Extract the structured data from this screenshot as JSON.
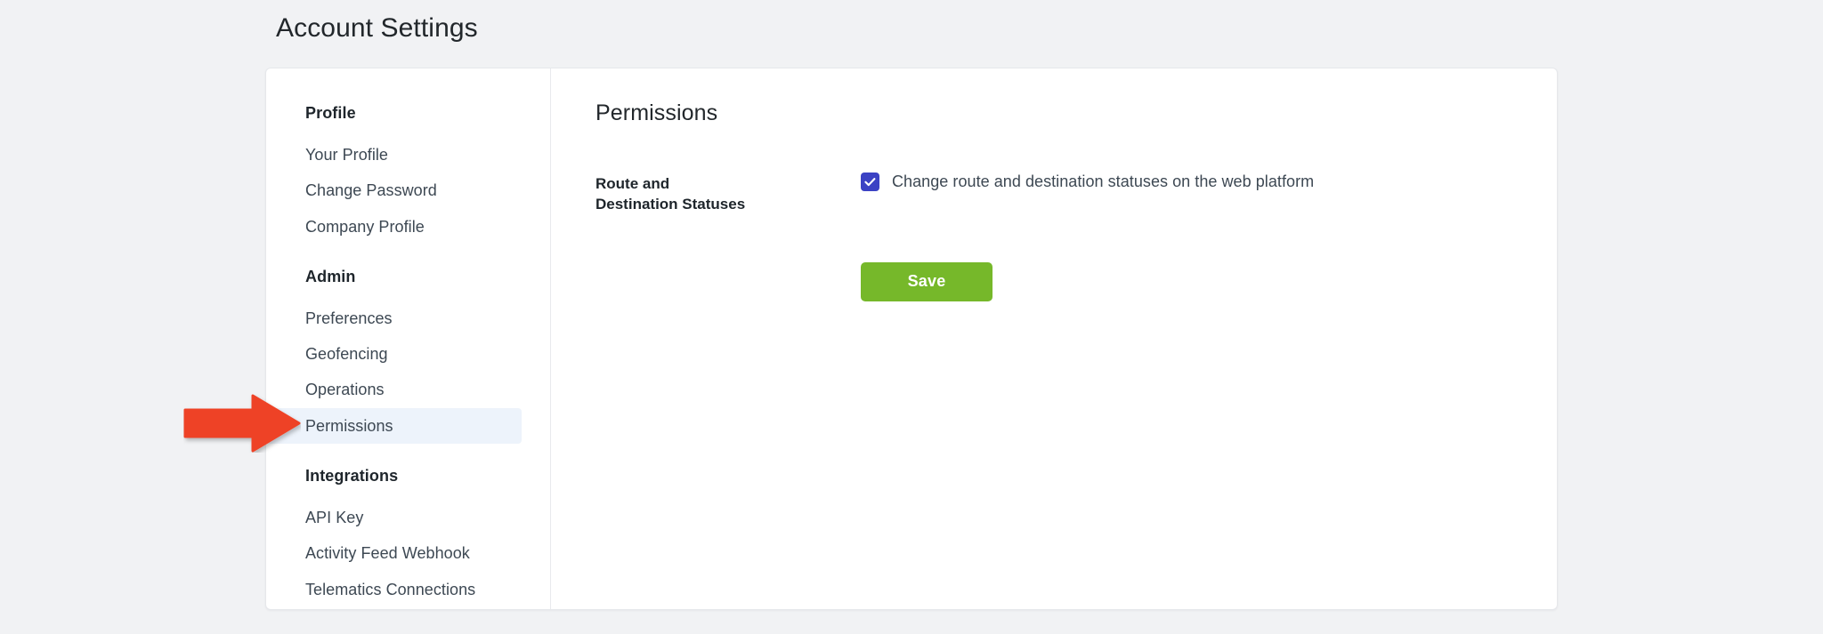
{
  "page": {
    "title": "Account Settings",
    "background_color": "#f1f2f4"
  },
  "sidebar": {
    "groups": [
      {
        "title": "Profile",
        "items": [
          {
            "label": "Your Profile",
            "active": false
          },
          {
            "label": "Change Password",
            "active": false
          },
          {
            "label": "Company Profile",
            "active": false
          }
        ]
      },
      {
        "title": "Admin",
        "items": [
          {
            "label": "Preferences",
            "active": false
          },
          {
            "label": "Geofencing",
            "active": false
          },
          {
            "label": "Operations",
            "active": false
          },
          {
            "label": "Permissions",
            "active": true
          }
        ]
      },
      {
        "title": "Integrations",
        "items": [
          {
            "label": "API Key",
            "active": false
          },
          {
            "label": "Activity Feed Webhook",
            "active": false
          },
          {
            "label": "Telematics Connections",
            "active": false
          }
        ]
      }
    ]
  },
  "content": {
    "title": "Permissions",
    "rows": [
      {
        "label_line1": "Route and",
        "label_line2": "Destination Statuses",
        "checkbox": {
          "label": "Change route and destination statuses on the web platform",
          "checked": true,
          "color": "#3b42c4",
          "icon": "checkmark-icon"
        }
      }
    ],
    "save_label": "Save",
    "save_color": "#76b82a"
  },
  "annotation": {
    "arrow": {
      "icon": "right-arrow-icon",
      "color": "#ee4326",
      "points_to": "Permissions"
    }
  }
}
